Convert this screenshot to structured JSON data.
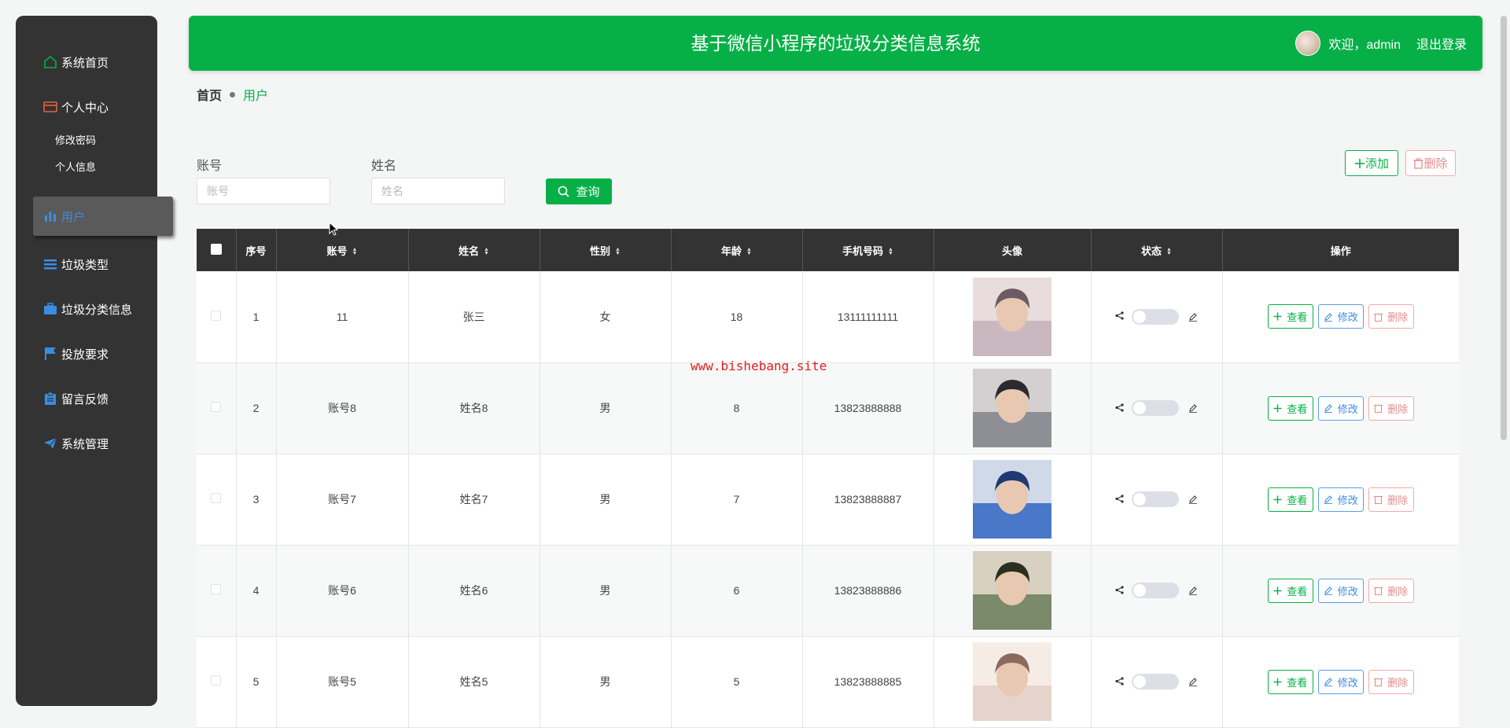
{
  "header": {
    "title": "基于微信小程序的垃圾分类信息系统",
    "welcome": "欢迎，admin",
    "logout": "退出登录"
  },
  "sidebar": {
    "items": [
      {
        "label": "系统首页",
        "icon": "home-icon"
      },
      {
        "label": "个人中心",
        "icon": "card-icon"
      },
      {
        "label": "修改密码"
      },
      {
        "label": "个人信息"
      },
      {
        "label": "用户",
        "icon": "bar-chart-icon"
      },
      {
        "label": "垃圾类型",
        "icon": "list-icon"
      },
      {
        "label": "垃圾分类信息",
        "icon": "briefcase-icon"
      },
      {
        "label": "投放要求",
        "icon": "flag-icon"
      },
      {
        "label": "留言反馈",
        "icon": "clipboard-icon"
      },
      {
        "label": "系统管理",
        "icon": "paper-plane-icon"
      }
    ]
  },
  "breadcrumb": {
    "home": "首页",
    "current": "用户"
  },
  "search": {
    "account_label": "账号",
    "account_placeholder": "账号",
    "name_label": "姓名",
    "name_placeholder": "姓名",
    "query_label": "查询"
  },
  "actions": {
    "add_label": "添加",
    "delete_label": "删除"
  },
  "table": {
    "columns": [
      "序号",
      "账号",
      "姓名",
      "性别",
      "年龄",
      "手机号码",
      "头像",
      "状态",
      "操作"
    ],
    "rows": [
      {
        "index": "1",
        "account": "11",
        "name": "张三",
        "gender": "女",
        "age": "18",
        "phone": "13111111111"
      },
      {
        "index": "2",
        "account": "账号8",
        "name": "姓名8",
        "gender": "男",
        "age": "8",
        "phone": "13823888888"
      },
      {
        "index": "3",
        "account": "账号7",
        "name": "姓名7",
        "gender": "男",
        "age": "7",
        "phone": "13823888887"
      },
      {
        "index": "4",
        "account": "账号6",
        "name": "姓名6",
        "gender": "男",
        "age": "6",
        "phone": "13823888886"
      },
      {
        "index": "5",
        "account": "账号5",
        "name": "姓名5",
        "gender": "男",
        "age": "5",
        "phone": "13823888885"
      }
    ],
    "row_actions": {
      "view": "查看",
      "edit": "修改",
      "delete": "删除"
    }
  },
  "watermark": "www.bishebang.site",
  "colors": {
    "accent": "#06b047",
    "sidebar": "#333333",
    "edit": "#3a8de0",
    "danger": "#e88a8a"
  }
}
